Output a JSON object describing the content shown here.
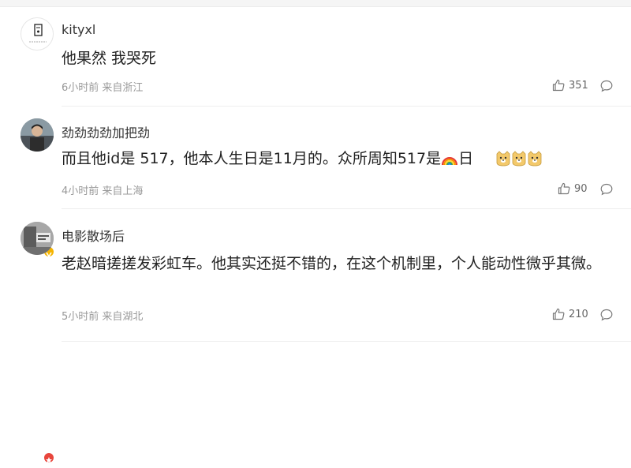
{
  "comments": [
    {
      "username": "kityxl",
      "text": "他果然 我哭死",
      "meta": "6小时前 来自浙江",
      "likes": "351"
    },
    {
      "username": "劲劲劲劲加把劲",
      "text_before": "而且他id是 517，他本人生日是11月的。众所周知517是",
      "text_after": "日",
      "meta": "4小时前 来自上海",
      "likes": "90",
      "emoji_icons": [
        "rainbow-icon",
        "doge-emoji",
        "doge-emoji",
        "doge-emoji"
      ]
    },
    {
      "username": "电影散场后",
      "text": "老赵暗搓搓发彩虹车。他其实还挺不错的，在这个机制里，个人能动性微乎其微。",
      "meta": "5小时前 来自湖北",
      "likes": "210"
    }
  ],
  "colors": {
    "verified_badge": "#f5b400",
    "red_badge": "#e8453c",
    "meta_text": "#999999"
  }
}
